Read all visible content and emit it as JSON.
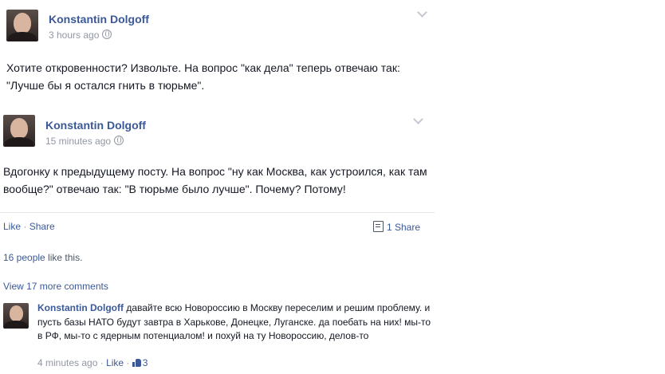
{
  "post1": {
    "author": "Konstantin Dolgoff",
    "time": "3 hours ago",
    "text": "Хотите откровенности? Извольте. На вопрос \"как дела\" теперь отвечаю так: \"Лучше бы я остался гнить в тюрьме\"."
  },
  "post2": {
    "author": "Konstantin Dolgoff",
    "time": "15 minutes ago",
    "text": "Вдогонку к предыдущему посту. На вопрос \"ну как Москва, как устроился, как там вообще?\" отвечаю так: \"В тюрьме было лучше\". Почему? Потому!",
    "like_label": "Like",
    "separator": " · ",
    "share_label": "Share",
    "share_count": "1 Share",
    "likes_count_link": "16 people",
    "likes_suffix": " like this.",
    "view_more": "View 17 more comments"
  },
  "comment": {
    "author": "Konstantin Dolgoff",
    "text": "давайте всю Новороссию в Москву переселим и решим проблему. и пусть базы НАТО будут завтра в Харькове, Донецке, Луганске. да поебать на них! мы-то в РФ, мы-то с ядерным потенциалом! и похуй на ту Новороссию, делов-то",
    "time": "4 minutes ago",
    "separator": " · ",
    "like_label": "Like",
    "separator2": " · ",
    "likes": "3"
  }
}
